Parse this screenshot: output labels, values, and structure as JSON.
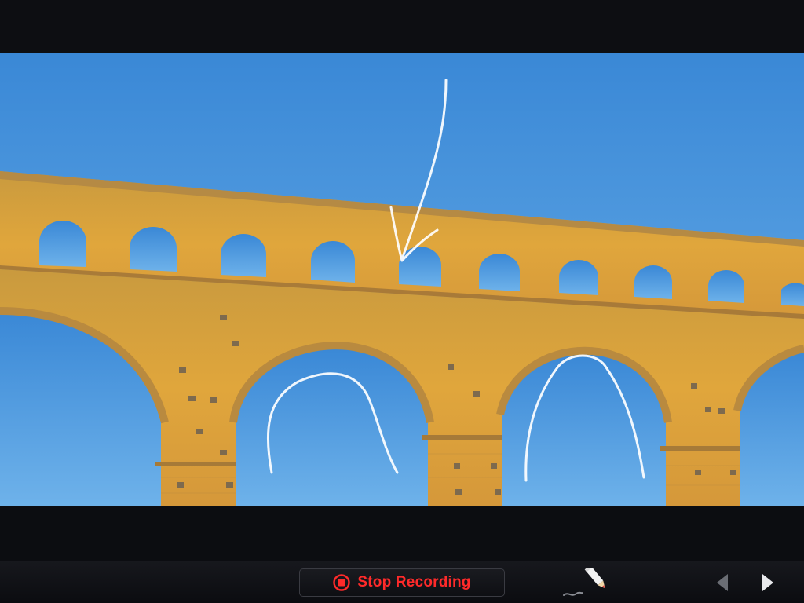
{
  "toolbar": {
    "stop_recording_label": "Stop Recording",
    "record_color": "#ff2a2a",
    "icons": {
      "stop": "stop-record-icon",
      "pen": "pen-icon",
      "previous": "previous-slide-icon",
      "next": "next-slide-icon"
    }
  },
  "slide": {
    "sky_color": "#3f8ed8",
    "stone_color": "#d9a441",
    "annotation_stroke_color": "#ffffff"
  }
}
